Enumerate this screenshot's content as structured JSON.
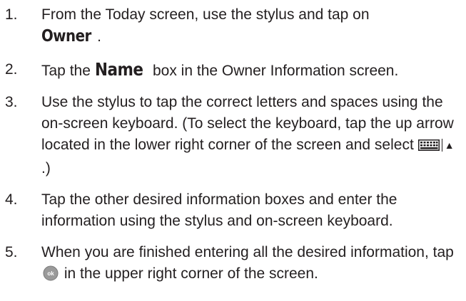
{
  "steps": [
    {
      "num": "1.",
      "parts": [
        "From the Today screen, use the stylus and tap on",
        "Owner",
        "."
      ]
    },
    {
      "num": "2.",
      "parts": [
        "Tap the",
        "Name",
        "box in the Owner Information screen."
      ]
    },
    {
      "num": "3.",
      "parts": [
        "Use the stylus to tap the correct letters and spaces using the on-screen keyboard. (To select the keyboard, tap the up arrow located in the lower right corner of the screen and select",
        "▲",
        ".)"
      ]
    },
    {
      "num": "4.",
      "parts": [
        "Tap the other desired information boxes and enter the information using the stylus and on-screen keyboard."
      ]
    },
    {
      "num": "5.",
      "parts": [
        "When you are finished entering all the desired information, tap",
        "in the upper right corner of the screen."
      ]
    }
  ],
  "icons": {
    "keyboard": "keyboard-icon",
    "ok": "ok-button-icon",
    "ok_label": "ok"
  },
  "colors": {
    "text": "#231f20",
    "ok_fill": "#9a9a9a"
  }
}
